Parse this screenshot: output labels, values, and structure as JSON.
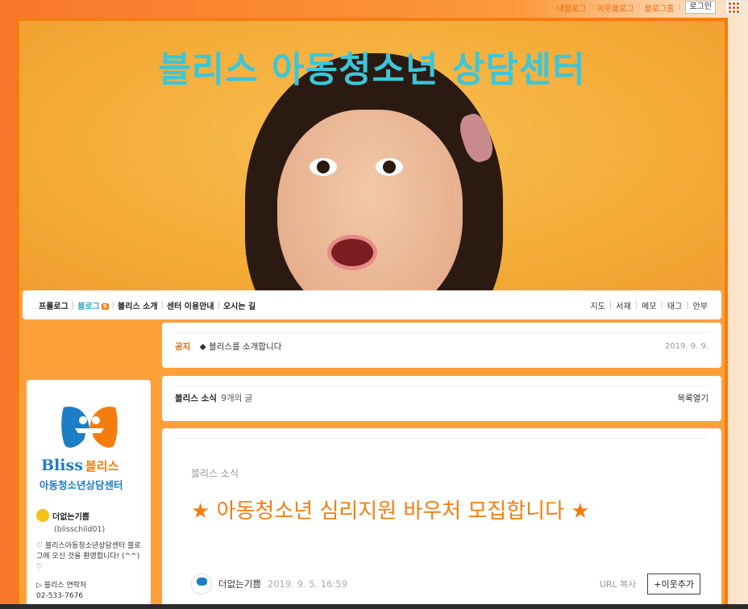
{
  "gnb": {
    "my_blog": "내블로그",
    "neighbor_blog": "이웃블로그",
    "blog_home": "블로그홈",
    "login": "로그인"
  },
  "header": {
    "title": "블리스 아동청소년 상담센터"
  },
  "menu": {
    "left": [
      {
        "label": "프롤로그"
      },
      {
        "label": "블로그",
        "badge": "9",
        "active": true
      },
      {
        "label": "블리스 소개"
      },
      {
        "label": "센터 이용안내"
      },
      {
        "label": "오시는 길"
      }
    ],
    "right": [
      {
        "label": "지도"
      },
      {
        "label": "서재"
      },
      {
        "label": "메모"
      },
      {
        "label": "태그"
      },
      {
        "label": "안부"
      }
    ]
  },
  "profile": {
    "logo_en": "Bliss",
    "logo_ko": "블리스",
    "logo_sub": "아동청소년상담센터",
    "nickname": "더없는기쁨",
    "user_id": "(blisschild01)",
    "intro": "♡ 블리스아동청소년상담센터 블로그에 오신 것을 환영합니다! (^^) ♡",
    "contact_label": "▷ 블리스 연락처",
    "contact_phone": "02-533-7676"
  },
  "notice": {
    "tag": "공지",
    "text": "◆ 블리스를 소개합니다",
    "date": "2019. 9. 9."
  },
  "category": {
    "name": "블리스 소식",
    "count": "9개의 글",
    "toggle": "목록열기"
  },
  "post": {
    "category": "블리스 소식",
    "title": "★ 아동청소년 심리지원 바우처 모집합니다 ★",
    "author": "더없는기쁨",
    "date": "2019. 9. 5. 16:59",
    "url_copy": "URL 복사",
    "add_neighbor": "+이웃추가"
  },
  "colors": {
    "accent": "#f57d10",
    "title": "#3cc6d9",
    "brand_blue": "#1c7ec4"
  }
}
